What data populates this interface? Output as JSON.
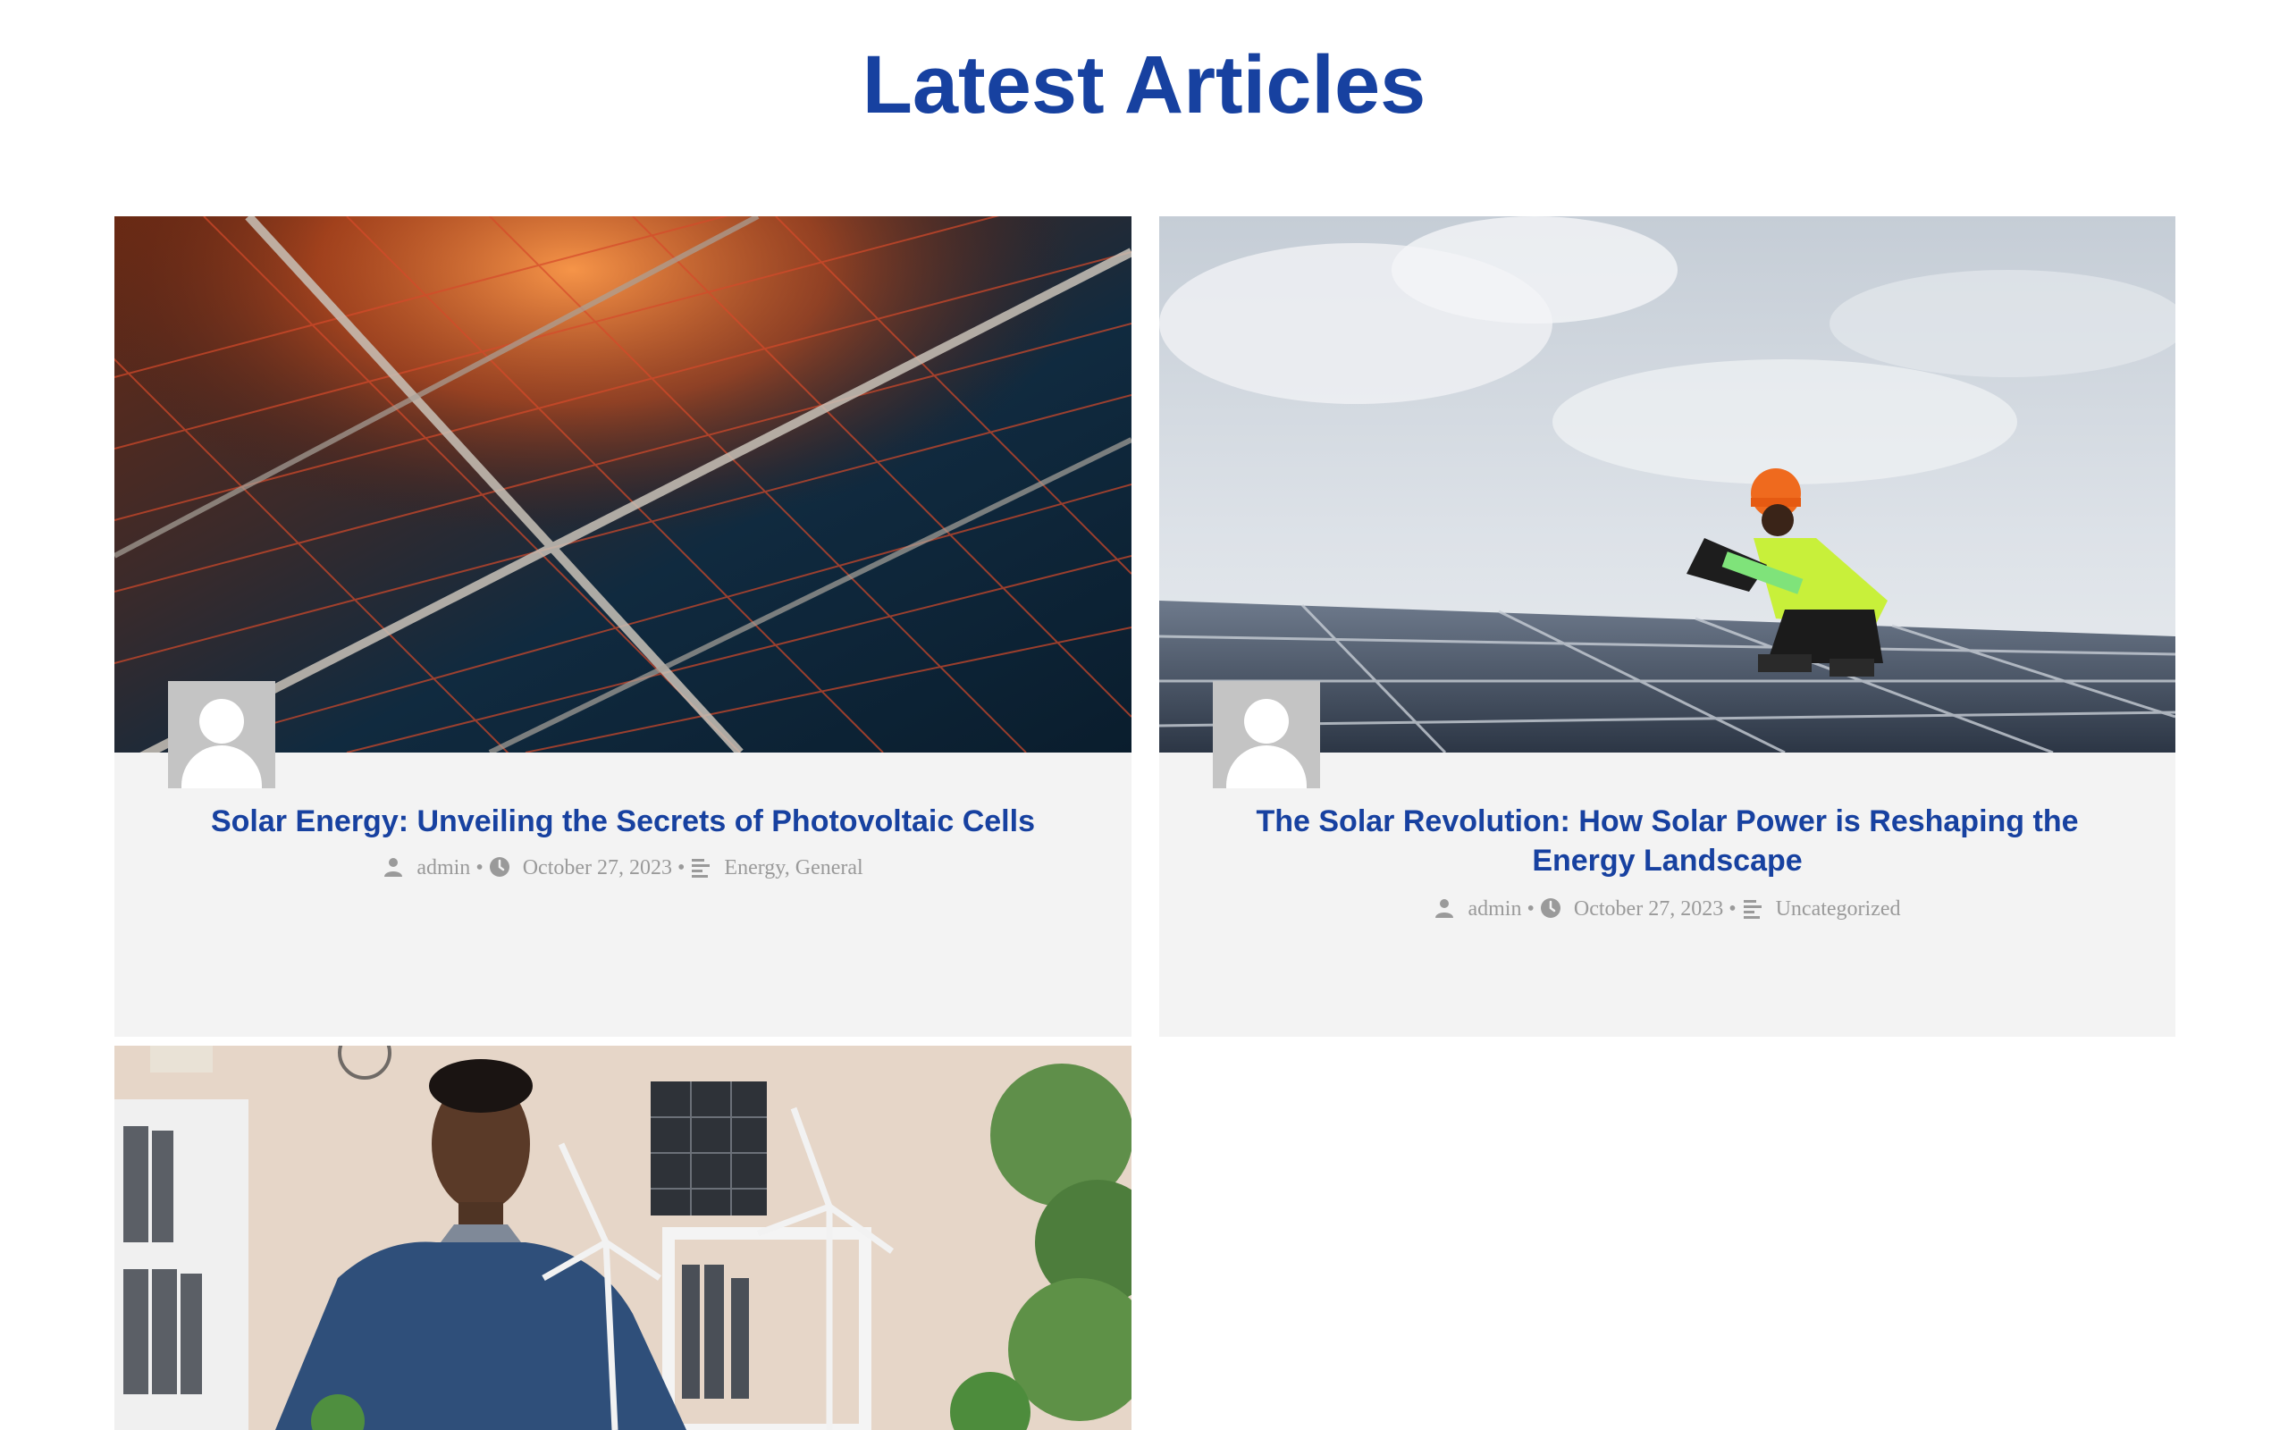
{
  "page": {
    "title": "Latest Articles"
  },
  "colors": {
    "accent": "#1741a0",
    "card_background": "#f3f3f3",
    "meta_text": "#9a9a9a",
    "avatar_background": "#c4c4c4"
  },
  "articles": [
    {
      "title": "Solar Energy: Unveiling the Secrets of Photovoltaic Cells",
      "author": "admin",
      "date": "October 27, 2023",
      "categories": "Energy, General",
      "image_description": "photo-solar-panel-closeup"
    },
    {
      "title": "The Solar Revolution: How Solar Power is Reshaping the Energy Landscape",
      "author": "admin",
      "date": "October 27, 2023",
      "categories": "Uncategorized",
      "image_description": "photo-worker-on-solar-roof"
    },
    {
      "title": "",
      "image_description": "photo-man-with-wind-turbine-models"
    }
  ],
  "meta": {
    "separator": "•"
  },
  "icons": {
    "author": "user-icon",
    "date": "clock-icon",
    "category": "category-lines-icon",
    "avatar": "avatar-placeholder-icon"
  }
}
